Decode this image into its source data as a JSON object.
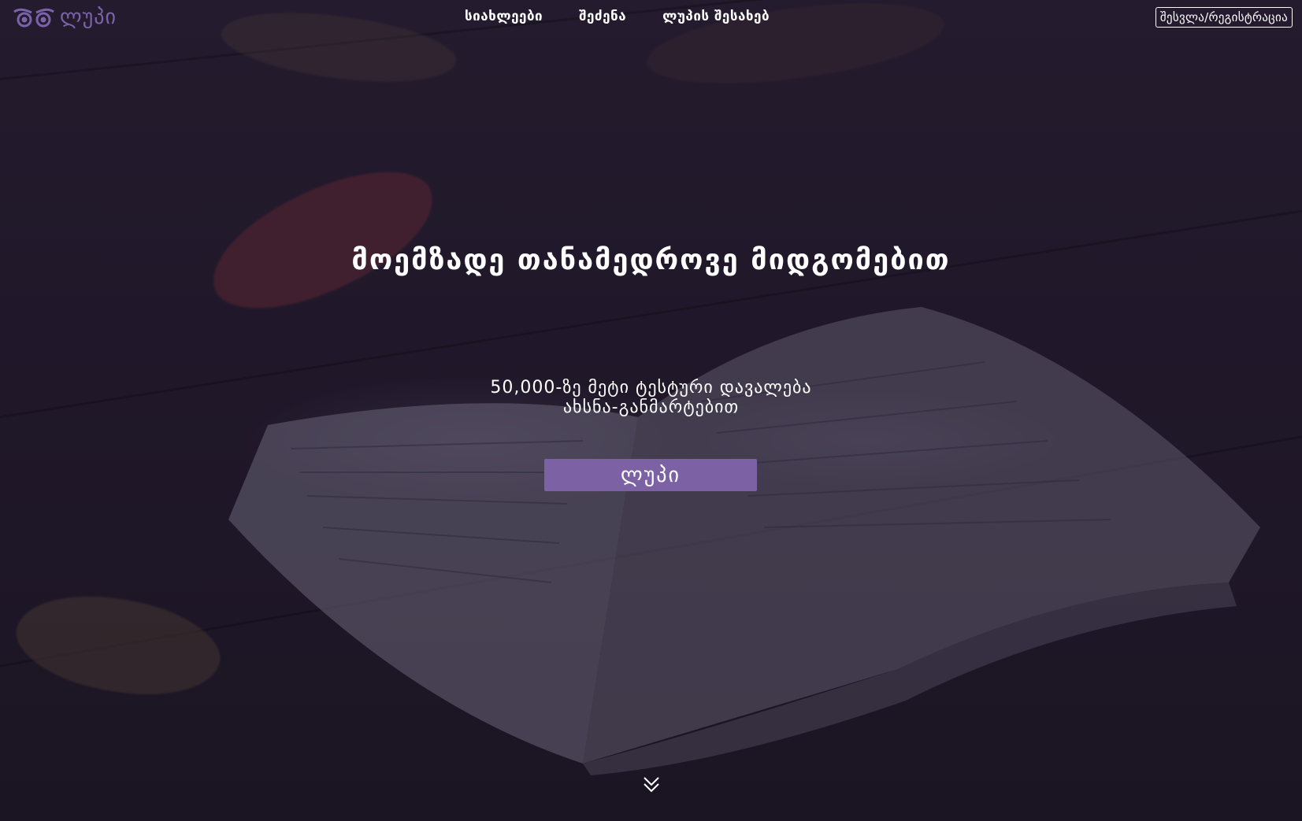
{
  "brand": {
    "name": "ლუპი",
    "accent_color": "#7c61a4",
    "logo_icon": "owl-eyes-icon"
  },
  "nav": {
    "items": [
      {
        "label": "სიახლეები"
      },
      {
        "label": "შეძენა"
      },
      {
        "label": "ლუპის შესახებ"
      }
    ],
    "login_label": "შესვლა/რეგისტრაცია"
  },
  "hero": {
    "headline": "მოემზადე თანამედროვე მიდგომებით",
    "subline_1": "50,000-ზე მეტი ტესტური დავალება",
    "subline_2": "ახსნა-განმარტებით",
    "cta_label": "ლუპი",
    "scroll_icon": "double-chevron-down-icon"
  }
}
